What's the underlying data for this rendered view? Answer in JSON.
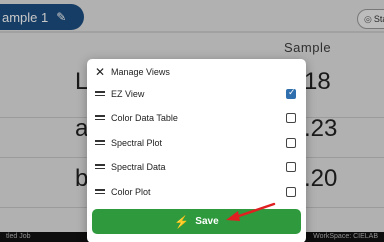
{
  "window": {
    "tab_label": "ample 1",
    "start_button": "Sta"
  },
  "main": {
    "column_header": "Sample",
    "rows": [
      {
        "label": "L",
        "value": "18"
      },
      {
        "label": "a",
        "value": ".23"
      },
      {
        "label": "b",
        "value": ".20"
      }
    ]
  },
  "footer": {
    "left": "tled Job",
    "right": "WorkSpace: CIELAB"
  },
  "dialog": {
    "title": "Manage Views",
    "items": [
      {
        "label": "EZ View",
        "checked": true
      },
      {
        "label": "Color Data Table",
        "checked": false
      },
      {
        "label": "Spectral Plot",
        "checked": false
      },
      {
        "label": "Spectral Data",
        "checked": false
      },
      {
        "label": "Color Plot",
        "checked": false
      }
    ],
    "save_label": "Save"
  },
  "colors": {
    "tab": "#1d4f82",
    "save": "#2e9a3d",
    "checkbox": "#2f6fae",
    "annotation_arrow": "#e02020"
  },
  "icons": {
    "tab": "pencil-icon",
    "start": "target-icon",
    "close": "close-icon",
    "handle": "drag-handle-icon",
    "save": "bolt-icon"
  }
}
